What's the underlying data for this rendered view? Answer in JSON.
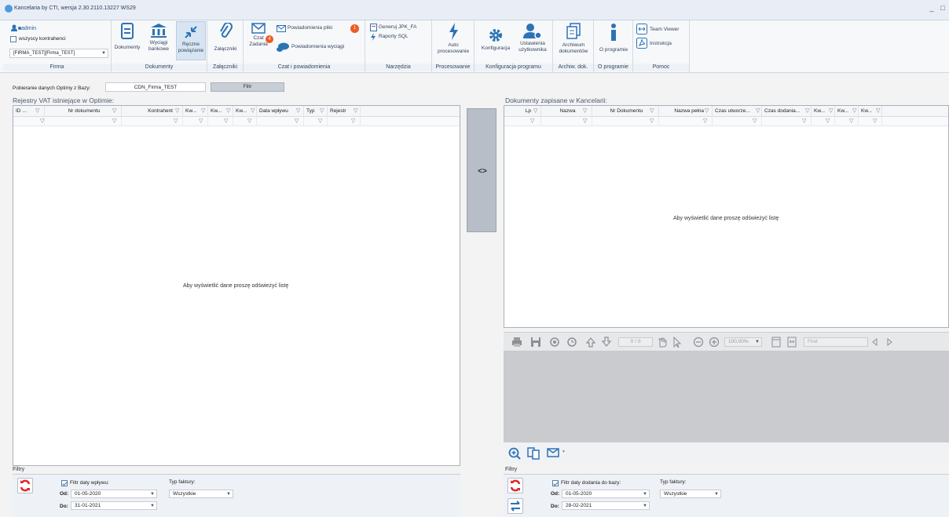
{
  "window": {
    "title": "Kancelaria by CTI, wersja 2.30.2110.13227 WS29",
    "controls": [
      "_",
      "□"
    ]
  },
  "ribbon": {
    "firma": {
      "user": "admin",
      "all_clients_label": "wszyscy kontrahenci",
      "all_clients_checked": false,
      "company_select": "[FIRMA_TEST][Firma_TEST]",
      "caption": "Firma"
    },
    "dokumenty": {
      "buttons": [
        "Dokumenty",
        "Wyciągi bankowe",
        "Ręczne powiązanie"
      ],
      "caption": "Dokumenty"
    },
    "zalaczniki": {
      "button": "Załączniki",
      "caption": "Załączniki"
    },
    "czat": {
      "chat_button": "Czat",
      "tasks_button": "Zadania",
      "badge_count": "4",
      "notif_files": "Powiadomienia pliki",
      "notif_files_badge": "1",
      "notif_statements": "Powiadomienia wyciągi",
      "caption": "Czat i powiadomienia"
    },
    "narzedzia": {
      "buttons": [
        "Generuj JPK_FA",
        "Raporty SQL"
      ],
      "caption": "Narzędzia"
    },
    "procesowanie": {
      "button": "Auto procesowanie",
      "caption": "Procesowanie"
    },
    "konfiguracja": {
      "buttons": [
        "Konfiguracja",
        "Ustawienia użytkownika"
      ],
      "caption": "Konfiguracja programu"
    },
    "archiwum": {
      "button": "Archiwum dokumentów",
      "caption": "Archiw. dok."
    },
    "oprogramie": {
      "button": "O programie",
      "caption": "O programie"
    },
    "pomoc": {
      "buttons": [
        "Team Viewer",
        "Instrukcja"
      ],
      "caption": "Pomoc"
    }
  },
  "source": {
    "label": "Pobieranie danych Optimy z Bazy:",
    "db_value": "CDN_Firma_TEST",
    "filter_button": "Filtr"
  },
  "left": {
    "title": "Rejestry VAT istniejące w Optimie:",
    "columns": [
      "ID ...",
      "Nr dokumentu",
      "Kontrahent",
      "Kw...",
      "Kw...",
      "Kw...",
      "Data wpływu",
      "Typ",
      "Rejestr"
    ],
    "empty": "Aby wyświetlić dane proszę odświeżyć listę",
    "filters": {
      "title": "Filtry",
      "date_filter_label": "Filtr daty wpływu:",
      "date_filter_checked": true,
      "from_label": "Od:",
      "from_value": "01-05-2020",
      "to_label": "Do:",
      "to_value": "31-01-2021",
      "type_label": "Typ faktury:",
      "type_value": "Wszystkie"
    }
  },
  "transfer": {
    "label": "<>"
  },
  "right": {
    "title": "Dokumenty zapisane w Kancelarii:",
    "columns": [
      "Lp",
      "Nazwa",
      "Nr Dokumentu",
      "Nazwa pełna",
      "Czas utworze...",
      "Czas dodania...",
      "Kw...",
      "Kw...",
      "Kw..."
    ],
    "empty": "Aby wyświetlić dane proszę odświeżyć listę",
    "viewer": {
      "page_counter": "0 / 0",
      "zoom": "100,00%",
      "find_placeholder": "Find"
    },
    "filters": {
      "title": "Filtry",
      "date_filter_label": "Filtr daty dodania do bazy:",
      "date_filter_checked": true,
      "from_label": "Od:",
      "from_value": "01-05-2020",
      "to_label": "Do:",
      "to_value": "28-02-2021",
      "type_label": "Typ faktury:",
      "type_value": "Wszystkie"
    }
  },
  "colors": {
    "accent": "#2c73b6",
    "refresh": "#e0262b",
    "badge": "#ef5a24"
  }
}
